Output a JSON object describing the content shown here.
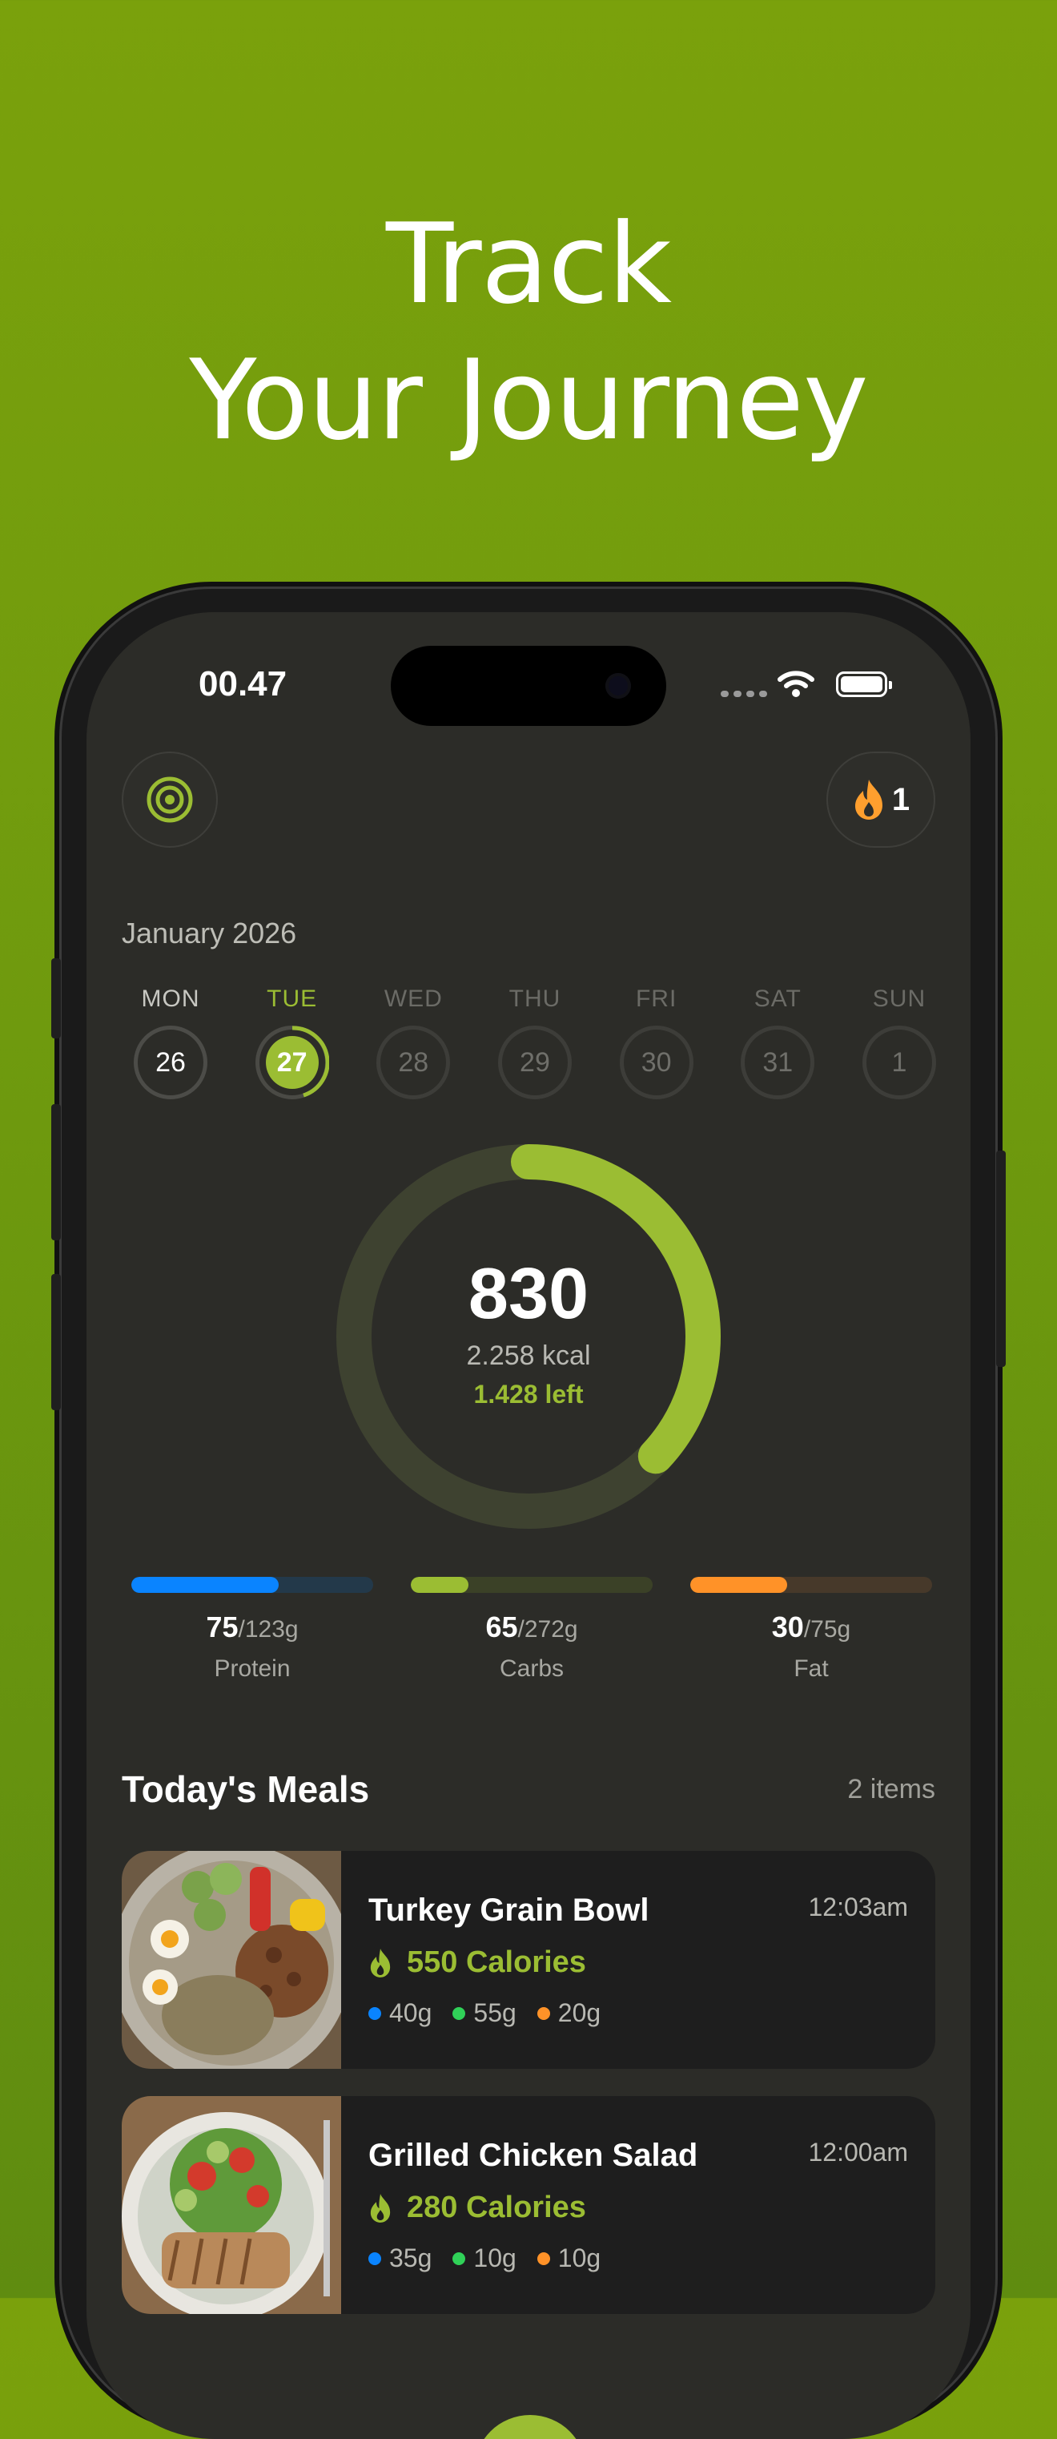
{
  "promo": {
    "line1": "Track",
    "line2": "Your Journey"
  },
  "status_bar": {
    "time": "00.47"
  },
  "header": {
    "streak_count": "1"
  },
  "calendar": {
    "month": "January 2026",
    "days": [
      {
        "label": "MON",
        "date": "26"
      },
      {
        "label": "TUE",
        "date": "27"
      },
      {
        "label": "WED",
        "date": "28"
      },
      {
        "label": "THU",
        "date": "29"
      },
      {
        "label": "FRI",
        "date": "30"
      },
      {
        "label": "SAT",
        "date": "31"
      },
      {
        "label": "SUN",
        "date": "1"
      }
    ],
    "selected_day": "TUE"
  },
  "calories": {
    "consumed": "830",
    "goal": "2.258 kcal",
    "left": "1.428 left",
    "progress_fraction": 0.37
  },
  "macros": [
    {
      "name": "Protein",
      "value": "75",
      "goal": "/123g",
      "fraction": 0.61,
      "color": "#0a84ff",
      "track": "#23394a"
    },
    {
      "name": "Carbs",
      "value": "65",
      "goal": "/272g",
      "fraction": 0.24,
      "color": "#9bbd33",
      "track": "#3b4127"
    },
    {
      "name": "Fat",
      "value": "30",
      "goal": "/75g",
      "fraction": 0.4,
      "color": "#ff9228",
      "track": "#47392a"
    }
  ],
  "meals_section": {
    "title": "Today's Meals",
    "count": "2 items"
  },
  "meals": [
    {
      "name": "Turkey Grain Bowl",
      "time": "12:03am",
      "calories": "550 Calories",
      "protein": "40g",
      "carbs": "55g",
      "fat": "20g"
    },
    {
      "name": "Grilled Chicken Salad",
      "time": "12:00am",
      "calories": "280 Calories",
      "protein": "35g",
      "carbs": "10g",
      "fat": "10g"
    }
  ],
  "colors": {
    "accent": "#9bbd33",
    "protein": "#0a84ff",
    "carbs": "#30d158",
    "fat": "#ff9228",
    "flame": "#ff9f2e"
  }
}
